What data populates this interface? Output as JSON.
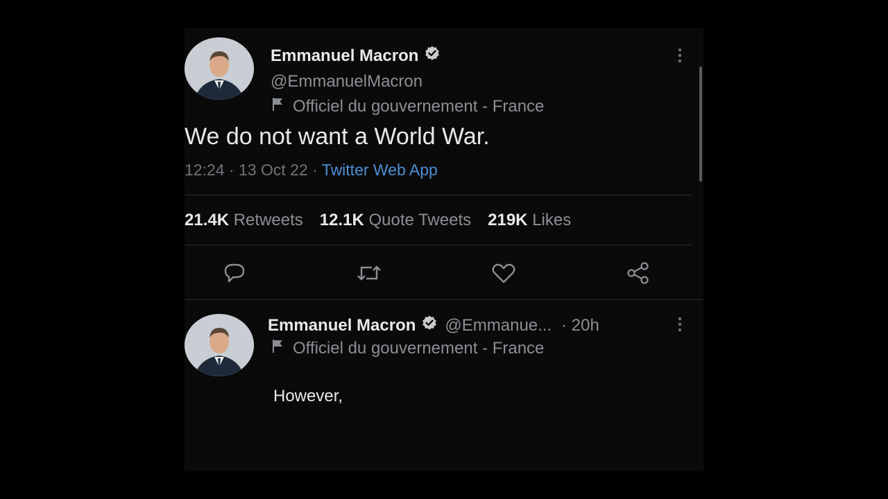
{
  "tweet": {
    "author_name": "Emmanuel Macron",
    "handle": "@EmmanuelMacron",
    "affiliation": "Officiel du gouvernement - France",
    "text": "We do not want a World War.",
    "time": "12:24",
    "date": "13 Oct 22",
    "separator": "·",
    "source": "Twitter Web App",
    "stats": {
      "retweets_count": "21.4K",
      "retweets_label": "Retweets",
      "quotes_count": "12.1K",
      "quotes_label": "Quote Tweets",
      "likes_count": "219K",
      "likes_label": "Likes"
    },
    "actions": [
      "reply-icon",
      "retweet-icon",
      "like-icon",
      "share-icon"
    ]
  },
  "reply": {
    "author_name": "Emmanuel Macron",
    "handle": "@Emmanue...",
    "age": "· 20h",
    "affiliation": "Officiel du gouvernement - France",
    "text": "However,"
  },
  "colors": {
    "background": "#0b0a0b",
    "text": "#e7e9ea",
    "muted": "#8b8f94",
    "link": "#4f8fd6"
  }
}
